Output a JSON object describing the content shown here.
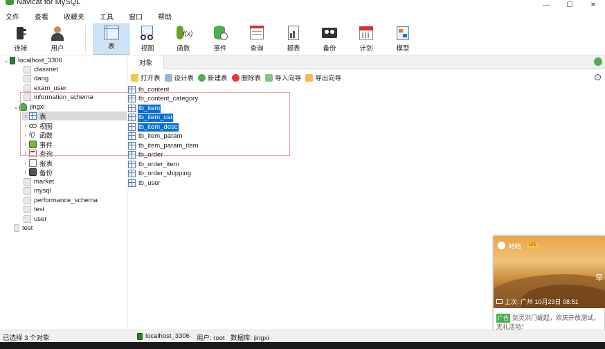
{
  "window": {
    "title": "Navicat for MySQL",
    "controls": [
      "—",
      "☐",
      "✕"
    ]
  },
  "menu": [
    "文件",
    "查看",
    "收藏夹",
    "工具",
    "窗口",
    "帮助"
  ],
  "toolbar": [
    {
      "label": "连接",
      "icon": "connection-icon"
    },
    {
      "label": "用户",
      "icon": "user-icon"
    },
    {
      "label": "表",
      "icon": "table-icon",
      "active": true
    },
    {
      "label": "视图",
      "icon": "view-icon"
    },
    {
      "label": "函数",
      "icon": "function-icon"
    },
    {
      "label": "事件",
      "icon": "event-icon"
    },
    {
      "label": "查询",
      "icon": "query-icon"
    },
    {
      "label": "报表",
      "icon": "report-icon"
    },
    {
      "label": "备份",
      "icon": "backup-icon"
    },
    {
      "label": "计划",
      "icon": "schedule-icon"
    },
    {
      "label": "模型",
      "icon": "model-icon"
    }
  ],
  "tree": {
    "server": "localhost_3306",
    "databases_before": [
      "classnet",
      "dang",
      "exam_user",
      "information_schema"
    ],
    "open_db": "jingxi",
    "open_db_children": [
      {
        "label": "表",
        "icon": "table",
        "selected": true
      },
      {
        "label": "视图",
        "icon": "view"
      },
      {
        "label": "函数",
        "icon": "function"
      },
      {
        "label": "事件",
        "icon": "event"
      },
      {
        "label": "查询",
        "icon": "query"
      },
      {
        "label": "报表",
        "icon": "report"
      },
      {
        "label": "备份",
        "icon": "backup"
      }
    ],
    "databases_after": [
      "market",
      "mysql",
      "performance_schema",
      "test",
      "user"
    ],
    "other_server": "test"
  },
  "objects_tab": "对象",
  "object_toolbar": [
    "打开表",
    "设计表",
    "新建表",
    "删除表",
    "导入向导",
    "导出向导"
  ],
  "tables": [
    {
      "name": "tb_content",
      "selected": false
    },
    {
      "name": "tb_content_category",
      "selected": false
    },
    {
      "name": "tb_item",
      "selected": true
    },
    {
      "name": "tb_item_cat",
      "selected": true
    },
    {
      "name": "tb_item_desc",
      "selected": true
    },
    {
      "name": "tb_item_param",
      "selected": false
    },
    {
      "name": "tb_item_param_item",
      "selected": false
    },
    {
      "name": "tb_order",
      "selected": false
    },
    {
      "name": "tb_order_item",
      "selected": false
    },
    {
      "name": "tb_order_shipping",
      "selected": false
    },
    {
      "name": "tb_user",
      "selected": false
    }
  ],
  "status": {
    "selection": "已选择 3 个对象",
    "server": "localhost_3306",
    "user": "用户: root",
    "database": "数据库: jingxi"
  },
  "popup": {
    "name": "晴睛",
    "level": "LV5",
    "side_char": "早",
    "last_login": "上次: 广州   10月23日 08:51",
    "ad_badge": "广告",
    "ad_text": "剑灵洪门崛起，欢庆开放测试，无礼活动！"
  },
  "colors": {
    "selection": "#0a6ed1",
    "active_tool": "#cfe3f7",
    "annotation": "#f0a0a0"
  }
}
